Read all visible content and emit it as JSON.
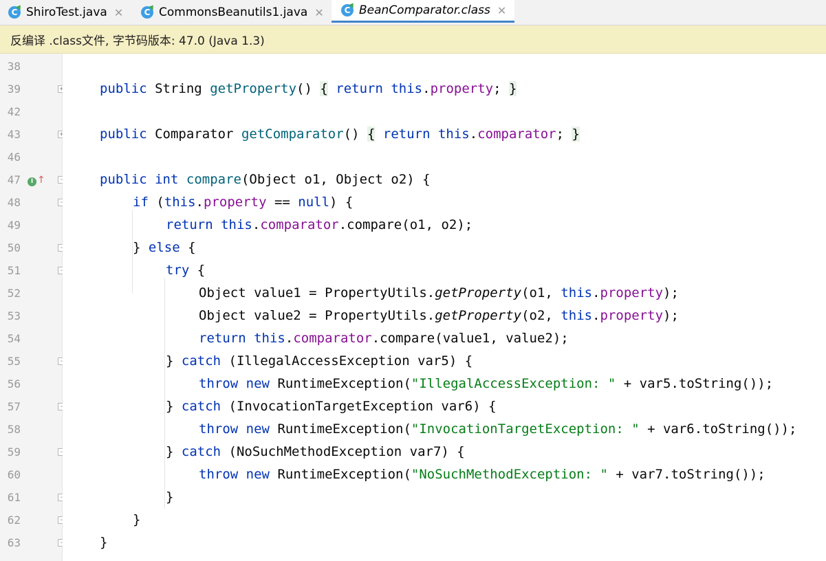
{
  "tabs": [
    {
      "label": "ShiroTest.java",
      "icon": "class-icon",
      "active": false
    },
    {
      "label": "CommonsBeanutils1.java",
      "icon": "class-icon",
      "active": false
    },
    {
      "label": "BeanComparator.class",
      "icon": "class-icon",
      "active": true
    }
  ],
  "tab_close_glyph": "✕",
  "class_icon_letter": "C",
  "banner": {
    "text": "反编译 .class文件, 字节码版本: 47.0 (Java 1.3)"
  },
  "line_numbers": [
    "38",
    "39",
    "42",
    "43",
    "46",
    "47",
    "48",
    "49",
    "50",
    "51",
    "52",
    "53",
    "54",
    "55",
    "56",
    "57",
    "58",
    "59",
    "60",
    "61",
    "62",
    "63"
  ],
  "code": {
    "kw_public": "public",
    "kw_return": "return",
    "kw_this": "this",
    "kw_int": "int",
    "kw_if": "if",
    "kw_null": "null",
    "kw_else": "else",
    "kw_try": "try",
    "kw_catch": "catch",
    "kw_throw": "throw",
    "kw_new": "new",
    "type_string": "String",
    "type_comparator": "Comparator",
    "type_object": "Object",
    "m_getProperty": "getProperty",
    "m_getComparator": "getComparator",
    "m_compare": "compare",
    "f_property": "property",
    "f_comparator": "comparator",
    "propertyUtils": "PropertyUtils",
    "runtimeException": "RuntimeException",
    "ex1": "IllegalAccessException",
    "ex2": "InvocationTargetException",
    "ex3": "NoSuchMethodException",
    "s1": "\"IllegalAccessException: \"",
    "s2": "\"InvocationTargetException: \"",
    "s3": "\"NoSuchMethodException: \"",
    "var5": "var5",
    "var6": "var6",
    "var7": "var7",
    "value1": "value1",
    "value2": "value2",
    "o1": "o1",
    "o2": "o2",
    "toString": "toString"
  },
  "colors": {
    "keyword": "#0033b3",
    "field": "#871094",
    "method": "#00627a",
    "string": "#067d17",
    "active_tab_underline": "#4083c9",
    "banner_bg": "#f5efc4"
  }
}
